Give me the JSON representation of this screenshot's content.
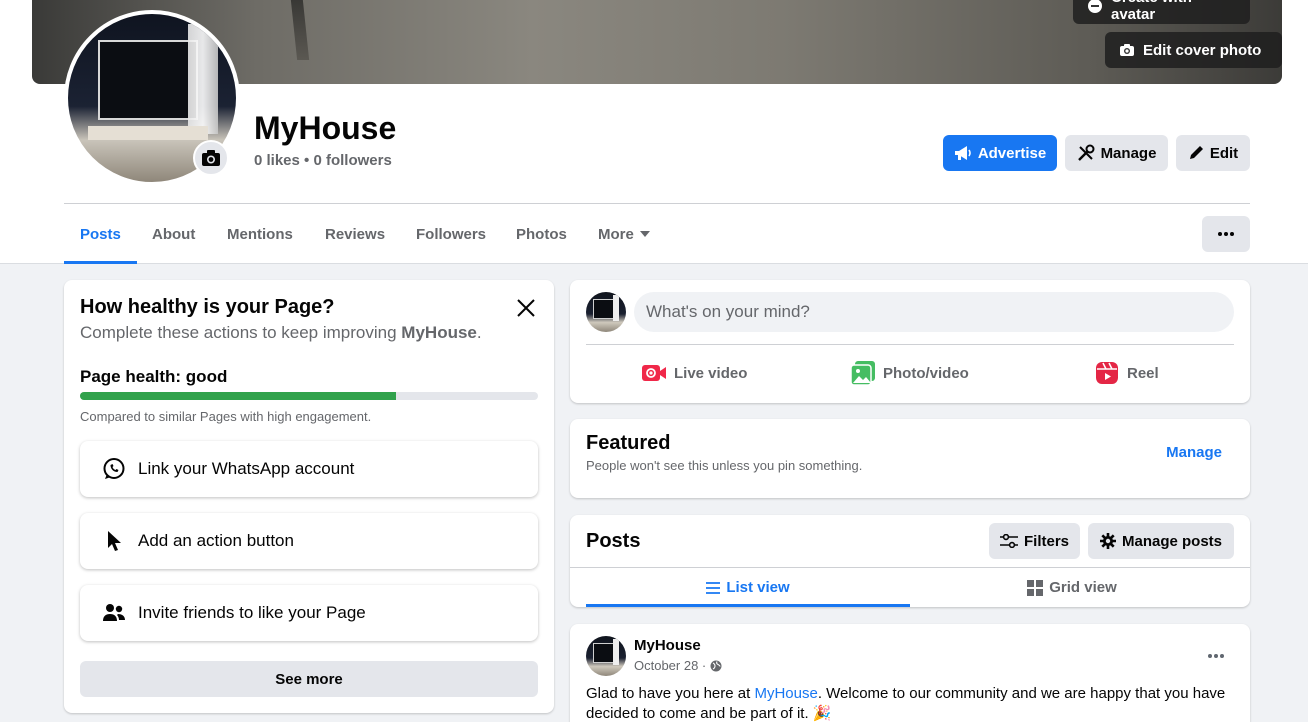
{
  "cover": {
    "create_avatar_label": "Create with avatar",
    "edit_cover_label": "Edit cover photo"
  },
  "page": {
    "name": "MyHouse",
    "stats": "0 likes • 0 followers"
  },
  "header_buttons": {
    "advertise": "Advertise",
    "manage": "Manage",
    "edit": "Edit"
  },
  "tabs": [
    {
      "label": "Posts",
      "active": true
    },
    {
      "label": "About"
    },
    {
      "label": "Mentions"
    },
    {
      "label": "Reviews"
    },
    {
      "label": "Followers"
    },
    {
      "label": "Photos"
    },
    {
      "label": "More"
    }
  ],
  "health": {
    "title": "How healthy is your Page?",
    "subtitle_prefix": "Complete these actions to keep improving ",
    "subtitle_name": "MyHouse",
    "subtitle_suffix": ".",
    "status_label": "Page health: good",
    "progress": 0.69,
    "compare_text": "Compared to similar Pages with high engagement.",
    "actions": [
      {
        "label": "Link your WhatsApp account",
        "icon": "whatsapp-icon"
      },
      {
        "label": "Add an action button",
        "icon": "cursor-icon"
      },
      {
        "label": "Invite friends to like your Page",
        "icon": "people-icon"
      }
    ],
    "see_more": "See more"
  },
  "composer": {
    "placeholder": "What's on your mind?",
    "actions": [
      {
        "label": "Live video",
        "icon": "live-video-icon",
        "color": "#f02849"
      },
      {
        "label": "Photo/video",
        "icon": "photo-icon",
        "color": "#45bd62"
      },
      {
        "label": "Reel",
        "icon": "reel-icon",
        "color": "#e42645"
      }
    ]
  },
  "featured": {
    "title": "Featured",
    "subtitle": "People won't see this unless you pin something.",
    "manage": "Manage"
  },
  "posts_section": {
    "title": "Posts",
    "filters": "Filters",
    "manage_posts": "Manage posts",
    "list_view": "List view",
    "grid_view": "Grid view"
  },
  "post": {
    "author": "MyHouse",
    "date": "October 28 ·",
    "text_prefix": "Glad to have you here at ",
    "text_link": "MyHouse",
    "text_suffix": ". Welcome to our community and we are happy that you have decided to come and be part of it. 🎉"
  },
  "colors": {
    "accent": "#1877f2",
    "health_bar": "#31a24c"
  }
}
